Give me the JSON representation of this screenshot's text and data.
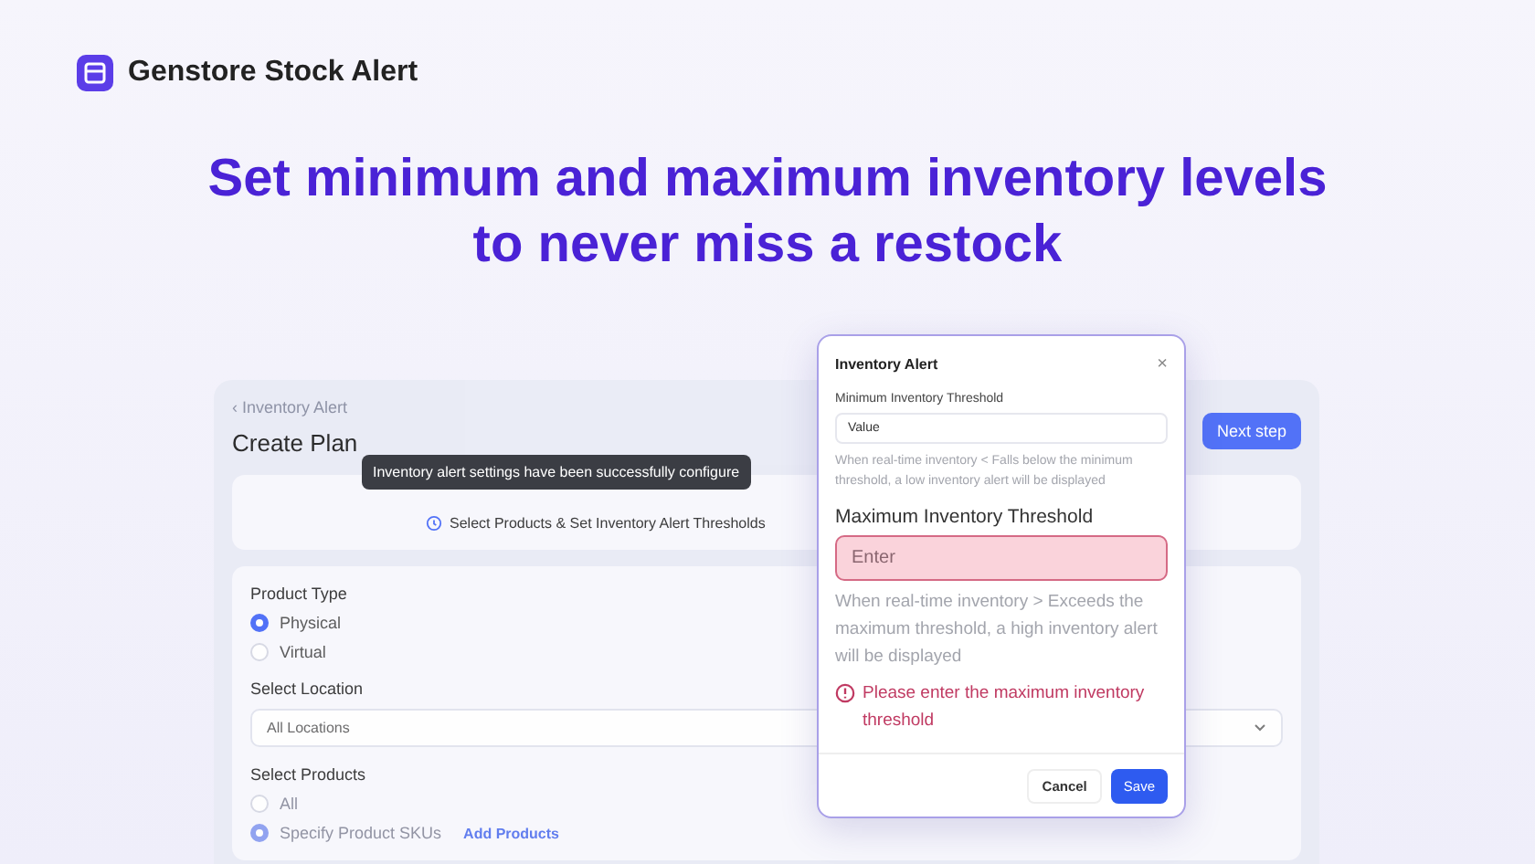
{
  "brand": {
    "name": "Genstore Stock Alert"
  },
  "headline": "Set minimum and maximum inventory levels to never miss a restock",
  "plan": {
    "breadcrumb": "Inventory Alert",
    "back": "‹",
    "title": "Create Plan",
    "next_button": "Next step",
    "step": "Select Products & Set Inventory Alert Thresholds",
    "toast": "Inventory alert settings have been successfully configure",
    "product_type": {
      "label": "Product Type",
      "options": [
        {
          "label": "Physical",
          "selected": true
        },
        {
          "label": "Virtual",
          "selected": false
        }
      ]
    },
    "location": {
      "label": "Select Location",
      "value": "All Locations"
    },
    "products": {
      "label": "Select Products",
      "options": [
        {
          "label": "All",
          "selected": false
        },
        {
          "label": "Specify Product SKUs",
          "selected": true,
          "link": "Add Products"
        }
      ]
    }
  },
  "dialog": {
    "title": "Inventory Alert",
    "close": "×",
    "min": {
      "label": "Minimum Inventory Threshold",
      "value": "Value",
      "hint": "When real-time inventory < Falls below the minimum threshold, a low inventory alert will be displayed"
    },
    "max": {
      "label": "Maximum Inventory Threshold",
      "placeholder": "Enter",
      "hint": "When real-time inventory > Exceeds the maximum threshold, a high inventory alert will be displayed",
      "error": "Please enter the maximum inventory threshold",
      "invalid": true
    },
    "buttons": [
      {
        "label": "Cancel",
        "kind": "secondary"
      },
      {
        "label": "Save",
        "kind": "primary"
      }
    ]
  }
}
